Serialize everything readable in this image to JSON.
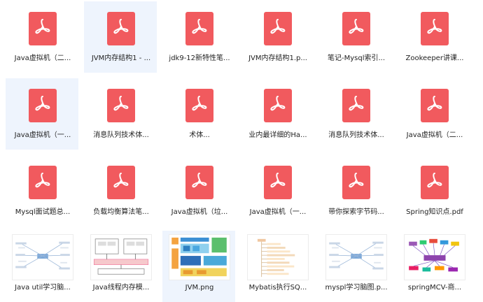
{
  "files": [
    {
      "label": "Java虚拟机（二...",
      "type": "pdf"
    },
    {
      "label": "JVM内存结构1 - ...",
      "type": "pdf",
      "state": "hover"
    },
    {
      "label": "jdk9-12新特性笔...",
      "type": "pdf"
    },
    {
      "label": "JVM内存结构1.p...",
      "type": "pdf"
    },
    {
      "label": "笔记-Mysql索引...",
      "type": "pdf"
    },
    {
      "label": "Zookeeper讲课...",
      "type": "pdf"
    },
    {
      "label": "Java虚拟机（一...",
      "type": "pdf",
      "state": "hover"
    },
    {
      "label": "消息队列技术体...",
      "type": "pdf"
    },
    {
      "label": "术体...",
      "type": "pdf"
    },
    {
      "label": "业内最详细的Ha...",
      "type": "pdf"
    },
    {
      "label": "消息队列技术体...",
      "type": "pdf"
    },
    {
      "label": "Java虚拟机（二...",
      "type": "pdf"
    },
    {
      "label": "Mysql面试题总...",
      "type": "pdf"
    },
    {
      "label": "负载均衡算法笔...",
      "type": "pdf"
    },
    {
      "label": "Java虚拟机（垃...",
      "type": "pdf"
    },
    {
      "label": "Java虚拟机（一...",
      "type": "pdf"
    },
    {
      "label": "带你探索字节码...",
      "type": "pdf"
    },
    {
      "label": "Spring知识点.pdf",
      "type": "pdf"
    },
    {
      "label": "Java util学习脑...",
      "type": "image",
      "thumb": "mindmap"
    },
    {
      "label": "Java线程内存模...",
      "type": "image",
      "thumb": "diagram"
    },
    {
      "label": "JVM.png",
      "type": "image",
      "thumb": "blocks",
      "state": "hover"
    },
    {
      "label": "Mybatis执行SQ...",
      "type": "image",
      "thumb": "tree"
    },
    {
      "label": "myspl学习脑图.p...",
      "type": "image",
      "thumb": "mindmap"
    },
    {
      "label": "springMCV-商...",
      "type": "image",
      "thumb": "colorful"
    }
  ],
  "colors": {
    "pdf_icon": "#f15a5e",
    "hover_bg": "#eef4fd"
  }
}
